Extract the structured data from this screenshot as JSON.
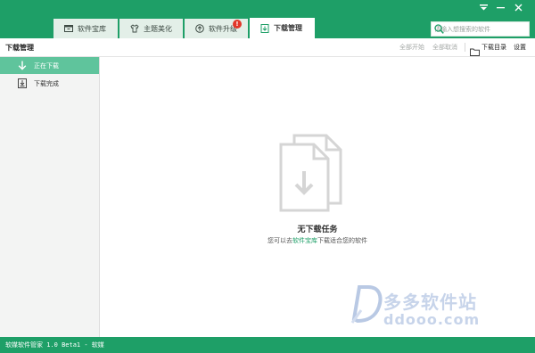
{
  "tabs": [
    {
      "label": "软件宝库",
      "icon": "store-icon"
    },
    {
      "label": "主题美化",
      "icon": "tshirt-icon"
    },
    {
      "label": "软件升级",
      "icon": "upgrade-icon"
    },
    {
      "label": "下载管理",
      "icon": "download-box-icon",
      "active": true
    }
  ],
  "upgrade_badge": "!",
  "search": {
    "placeholder": "请输入想搜索的软件"
  },
  "toolbar": {
    "title": "下载管理",
    "start_all": "全部开始",
    "cancel_all": "全部取消",
    "download_dir": "下载目录",
    "settings": "设置"
  },
  "sidebar": {
    "items": [
      {
        "label": "正在下载",
        "icon": "arrow-down-icon",
        "active": true
      },
      {
        "label": "下载完成",
        "icon": "completed-icon",
        "active": false
      }
    ]
  },
  "empty_state": {
    "title": "无下载任务",
    "prefix": "您可以去",
    "link": "软件宝库",
    "suffix": "下载适合您的软件"
  },
  "statusbar": {
    "text": "软媒软件管家 1.0 Beta1 - 软媒"
  },
  "watermark": {
    "brand": "多多软件站",
    "url": "ddooo.com"
  },
  "colors": {
    "brand_green": "#1e9f67",
    "active_item": "#5fc49c",
    "link": "#1e9f67",
    "badge": "#e2372a"
  }
}
